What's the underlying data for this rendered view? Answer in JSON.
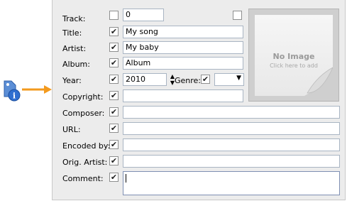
{
  "callout": {
    "icon": "tag-info-icon",
    "arrow_color": "#f39a1e"
  },
  "fields": {
    "track": {
      "label": "Track:",
      "checked": false,
      "value": "0"
    },
    "title": {
      "label": "Title:",
      "checked": true,
      "value": "My song"
    },
    "artist": {
      "label": "Artist:",
      "checked": true,
      "value": "My baby"
    },
    "album": {
      "label": "Album:",
      "checked": true,
      "value": "Album"
    },
    "year": {
      "label": "Year:",
      "checked": true,
      "value": "2010"
    },
    "genre": {
      "label": "Genre:",
      "checked": true,
      "value": ""
    },
    "copyright": {
      "label": "Copyright:",
      "checked": true,
      "value": ""
    },
    "composer": {
      "label": "Composer:",
      "checked": true,
      "value": ""
    },
    "url": {
      "label": "URL:",
      "checked": true,
      "value": ""
    },
    "encoded_by": {
      "label": "Encoded by:",
      "checked": true,
      "value": ""
    },
    "orig_artist": {
      "label": "Orig. Artist:",
      "checked": true,
      "value": ""
    },
    "comment": {
      "label": "Comment:",
      "checked": true,
      "value": ""
    }
  },
  "cover": {
    "checked": false,
    "title": "No Image",
    "subtitle": "Click here to add"
  },
  "glyphs": {
    "check": "✔",
    "spin_up": "▲",
    "spin_down": "▼",
    "dropdown": "▼"
  }
}
